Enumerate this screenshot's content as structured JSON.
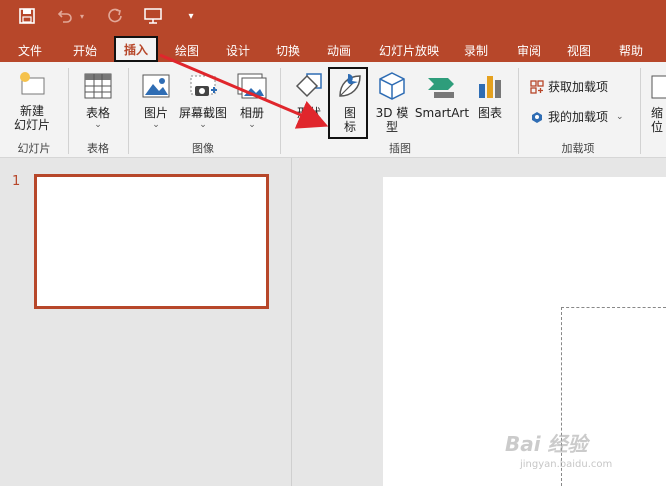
{
  "tabs": [
    {
      "label": "文件"
    },
    {
      "label": "开始"
    },
    {
      "label": "插入"
    },
    {
      "label": "绘图"
    },
    {
      "label": "设计"
    },
    {
      "label": "切换"
    },
    {
      "label": "动画"
    },
    {
      "label": "幻灯片放映"
    },
    {
      "label": "录制"
    },
    {
      "label": "审阅"
    },
    {
      "label": "视图"
    },
    {
      "label": "帮助"
    }
  ],
  "ribbon": {
    "slides": {
      "new_slide_line1": "新建",
      "new_slide_line2": "幻灯片",
      "group": "幻灯片"
    },
    "tables": {
      "table": "表格",
      "group": "表格"
    },
    "images": {
      "picture": "图片",
      "screenshot": "屏幕截图",
      "album": "相册",
      "group": "图像"
    },
    "illustrations": {
      "shapes": "形状",
      "icons_line1": "图",
      "icons_line2": "标",
      "model3d_line1": "3D 模",
      "model3d_line2": "型",
      "smartart": "SmartArt",
      "chart": "图表",
      "group": "插图"
    },
    "addins": {
      "get": "获取加载项",
      "mine": "我的加载项",
      "group": "加载项"
    },
    "zoom": {
      "line1": "缩",
      "line2": "位"
    }
  },
  "thumbnails": {
    "slide_number": "1"
  },
  "watermark": {
    "text": "Bai 经验",
    "sub": "jingyan.baidu.com"
  },
  "colors": {
    "accent": "#b7472a",
    "ribbon_bg": "#f3f3f3",
    "workspace_bg": "#e6e6e6",
    "annotation": "#e0262c"
  }
}
